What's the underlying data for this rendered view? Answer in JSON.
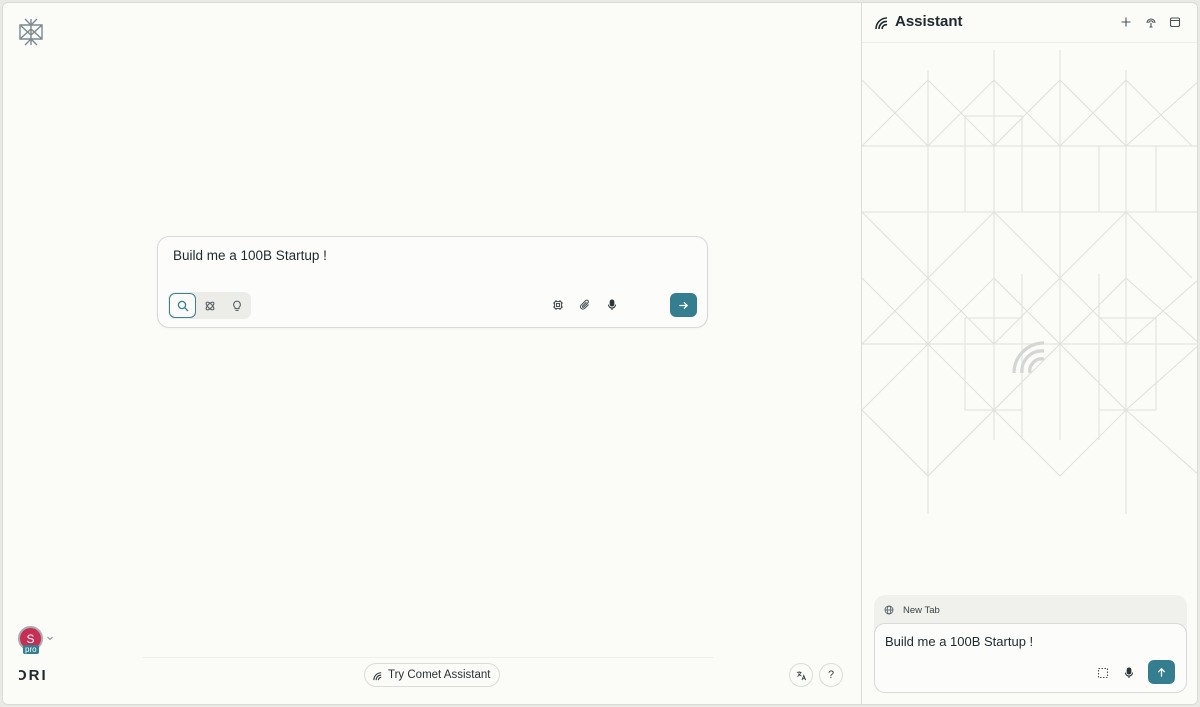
{
  "main": {
    "composer": {
      "text": "Build me a 100B Startup !",
      "modes": [
        {
          "name": "search",
          "active": true
        },
        {
          "name": "research",
          "active": false
        },
        {
          "name": "labs",
          "active": false
        }
      ],
      "tools": [
        "model-chip-icon",
        "paperclip-icon",
        "microphone-icon"
      ],
      "send_icon": "arrow-right-icon"
    },
    "avatar": {
      "initial": "S",
      "badge": "pro"
    },
    "brand_fragment": "ORI",
    "footer": {
      "try_comet_label": "Try Comet Assistant",
      "translate_icon": "translate-icon",
      "help_label": "?"
    }
  },
  "assistant": {
    "title": "Assistant",
    "header_buttons": [
      "plus-icon",
      "broadcast-icon",
      "window-icon"
    ],
    "tab_label": "New Tab",
    "input_text": "Build me a 100B Startup !",
    "tools": [
      "select-area-icon",
      "microphone-icon"
    ],
    "send_icon": "arrow-up-icon"
  },
  "colors": {
    "accent": "#357e90",
    "avatar": "#c62e53",
    "background": "#fbfbf8",
    "border": "#d7dad6"
  }
}
